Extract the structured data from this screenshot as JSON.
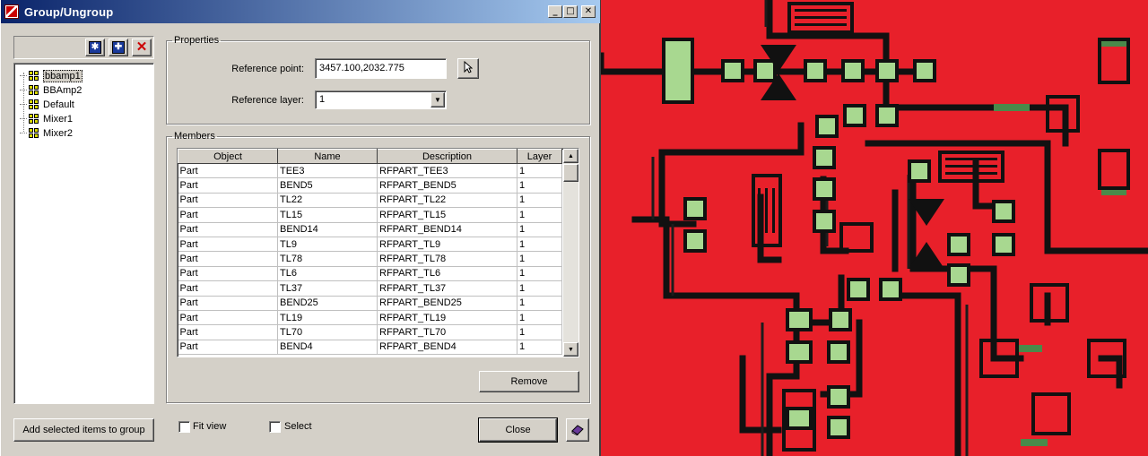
{
  "window": {
    "title": "Group/Ungroup"
  },
  "title_buttons": {
    "minimize": "_",
    "maximize": "□",
    "close": "✕"
  },
  "toolbar": {
    "new_icon": "new-group-icon",
    "add_icon": "add-group-icon",
    "delete_icon": "delete-icon",
    "delete_glyph": "✕"
  },
  "groups": [
    "bbamp1",
    "BBAmp2",
    "Default",
    "Mixer1",
    "Mixer2"
  ],
  "selected_group": "bbamp1",
  "properties": {
    "legend": "Properties",
    "reference_point_label": "Reference point:",
    "reference_point_value": "3457.100,2032.775",
    "reference_layer_label": "Reference layer:",
    "reference_layer_value": "1"
  },
  "members": {
    "legend": "Members",
    "columns": [
      "Object",
      "Name",
      "Description",
      "Layer"
    ],
    "rows": [
      [
        "Part",
        "TEE3",
        "RFPART_TEE3",
        "1"
      ],
      [
        "Part",
        "BEND5",
        "RFPART_BEND5",
        "1"
      ],
      [
        "Part",
        "TL22",
        "RFPART_TL22",
        "1"
      ],
      [
        "Part",
        "TL15",
        "RFPART_TL15",
        "1"
      ],
      [
        "Part",
        "BEND14",
        "RFPART_BEND14",
        "1"
      ],
      [
        "Part",
        "TL9",
        "RFPART_TL9",
        "1"
      ],
      [
        "Part",
        "TL78",
        "RFPART_TL78",
        "1"
      ],
      [
        "Part",
        "TL6",
        "RFPART_TL6",
        "1"
      ],
      [
        "Part",
        "TL37",
        "RFPART_TL37",
        "1"
      ],
      [
        "Part",
        "BEND25",
        "RFPART_BEND25",
        "1"
      ],
      [
        "Part",
        "TL19",
        "RFPART_TL19",
        "1"
      ],
      [
        "Part",
        "TL70",
        "RFPART_TL70",
        "1"
      ],
      [
        "Part",
        "BEND4",
        "RFPART_BEND4",
        "1"
      ]
    ]
  },
  "buttons": {
    "remove": "Remove",
    "add_selected": "Add selected items to group",
    "close": "Close"
  },
  "checkboxes": {
    "fit_view": "Fit view",
    "select": "Select"
  },
  "colors": {
    "board": "#e8202a",
    "trace": "#111111",
    "pad": "#a8d890",
    "title_start": "#0a246a",
    "title_end": "#a6caf0"
  }
}
